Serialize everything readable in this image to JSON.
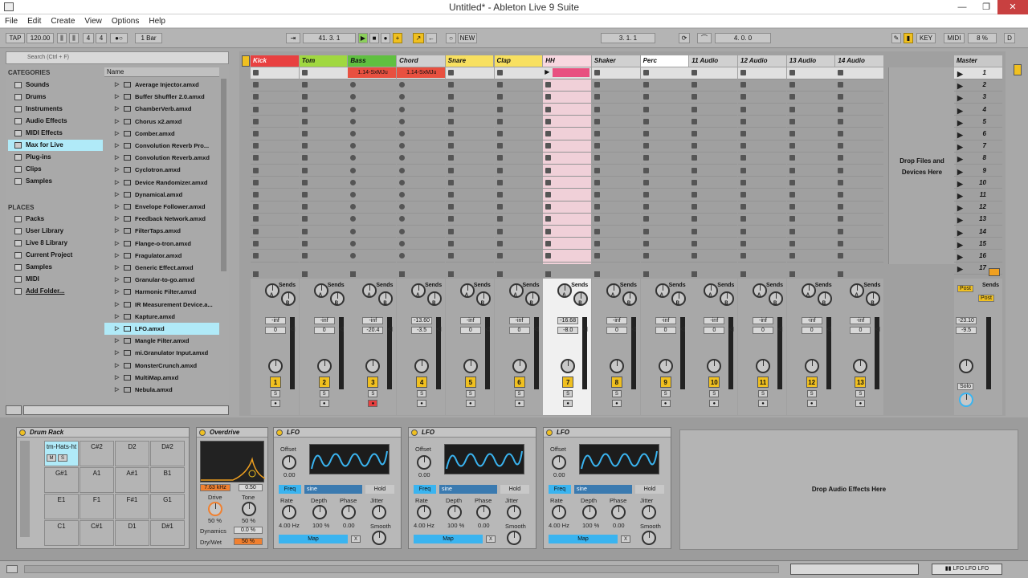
{
  "window": {
    "title": "Untitled* - Ableton Live 9 Suite",
    "minimize": "—",
    "maximize": "❐",
    "close": "✕"
  },
  "menu": [
    "File",
    "Edit",
    "Create",
    "View",
    "Options",
    "Help"
  ],
  "transport": {
    "tap": "TAP",
    "tempo": "120.00",
    "sig_num": "4",
    "sig_den": "4",
    "quant": "1 Bar",
    "position": "41.  3.  1",
    "new": "NEW",
    "loop_start": "3.  1.  1",
    "loop_len": "4.  0.  0",
    "key": "KEY",
    "midi": "MIDI",
    "cpu": "8 %",
    "d": "D"
  },
  "browser": {
    "search_placeholder": "Search (Ctrl + F)",
    "categories_title": "CATEGORIES",
    "categories": [
      "Sounds",
      "Drums",
      "Instruments",
      "Audio Effects",
      "MIDI Effects",
      "Max for Live",
      "Plug-ins",
      "Clips",
      "Samples"
    ],
    "places_title": "PLACES",
    "places": [
      "Packs",
      "User Library",
      "Live 8 Library",
      "Current Project",
      "Samples",
      "MIDI",
      "Add Folder..."
    ],
    "name_col": "Name",
    "files": [
      "Average Injector.amxd",
      "Buffer Shuffler 2.0.amxd",
      "ChamberVerb.amxd",
      "Chorus x2.amxd",
      "Comber.amxd",
      "Convolution Reverb Pro...",
      "Convolution Reverb.amxd",
      "Cyclotron.amxd",
      "Device Randomizer.amxd",
      "Dynamical.amxd",
      "Envelope Follower.amxd",
      "Feedback Network.amxd",
      "FilterTaps.amxd",
      "Flange-o-tron.amxd",
      "Fragulator.amxd",
      "Generic Effect.amxd",
      "Granular-to-go.amxd",
      "Harmonic Filter.amxd",
      "IR Measurement Device.a...",
      "Kapture.amxd",
      "LFO.amxd",
      "Mangle Filter.amxd",
      "mi.Granulator Input.amxd",
      "MonsterCrunch.amxd",
      "MultiMap.amxd",
      "Nebula.amxd"
    ]
  },
  "tracks": [
    {
      "name": "Kick",
      "color": "#e84040",
      "num": "1",
      "vol": "-inf",
      "pan": "0"
    },
    {
      "name": "Tom",
      "color": "#a0d840",
      "num": "2",
      "vol": "-inf",
      "pan": "0"
    },
    {
      "name": "Bass",
      "color": "#60c040",
      "num": "3",
      "vol": "-inf",
      "pan": "-20.4"
    },
    {
      "name": "Chord",
      "color": "#d0d0d0",
      "num": "4",
      "vol": "-13.60",
      "pan": "-3.5"
    },
    {
      "name": "Snare",
      "color": "#f8e060",
      "num": "5",
      "vol": "-inf",
      "pan": "0"
    },
    {
      "name": "Clap",
      "color": "#f8e060",
      "num": "6",
      "vol": "-inf",
      "pan": "0"
    },
    {
      "name": "HH",
      "color": "#f8d8e0",
      "num": "7",
      "vol": "-16.68",
      "pan": "-8.0"
    },
    {
      "name": "Shaker",
      "color": "#d0d0d0",
      "num": "8",
      "vol": "-inf",
      "pan": "0"
    },
    {
      "name": "Perc",
      "color": "#ffffff",
      "num": "9",
      "vol": "-inf",
      "pan": "0"
    },
    {
      "name": "11 Audio",
      "color": "#d0d0d0",
      "num": "10",
      "vol": "-inf",
      "pan": "0"
    },
    {
      "name": "12 Audio",
      "color": "#d0d0d0",
      "num": "11",
      "vol": "-inf",
      "pan": "0"
    },
    {
      "name": "13 Audio",
      "color": "#d0d0d0",
      "num": "12",
      "vol": "-inf",
      "pan": "0"
    },
    {
      "name": "14 Audio",
      "color": "#d0d0d0",
      "num": "13",
      "vol": "-inf",
      "pan": "0"
    }
  ],
  "clips": {
    "bass": "1.14-SxMJu",
    "chord": "1.14-SxMJu"
  },
  "drop_files": "Drop Files and Devices Here",
  "master": {
    "name": "Master",
    "vol": "-23.10",
    "pan": "-9.5",
    "post": "Post",
    "solo": "Solo",
    "scenes": [
      "1",
      "2",
      "3",
      "4",
      "5",
      "6",
      "7",
      "8",
      "9",
      "10",
      "11",
      "12",
      "13",
      "14",
      "15",
      "16",
      "17"
    ]
  },
  "sends_label": "Sends",
  "drum_rack": {
    "title": "Drum Rack",
    "pads": [
      "tm-Hats-ht",
      "C#2",
      "D2",
      "D#2",
      "G#1",
      "A1",
      "A#1",
      "B1",
      "E1",
      "F1",
      "F#1",
      "G1",
      "C1",
      "C#1",
      "D1",
      "D#1"
    ],
    "mute": "M",
    "solo": "S"
  },
  "overdrive": {
    "title": "Overdrive",
    "freq": "7.63 kHz",
    "width": "0.50",
    "drive_label": "Drive",
    "tone_label": "Tone",
    "drive": "50 %",
    "tone": "50 %",
    "dynamics_label": "Dynamics",
    "dynamics": "0.0 %",
    "drywet_label": "Dry/Wet",
    "drywet": "50 %"
  },
  "lfo": {
    "title": "LFO",
    "offset_label": "Offset",
    "offset": "0.00",
    "freq": "Freq",
    "wave": "sine",
    "hold": "Hold",
    "rate_label": "Rate",
    "depth_label": "Depth",
    "phase_label": "Phase",
    "jitter_label": "Jitter",
    "rate": "4.00 Hz",
    "depth": "100 %",
    "phase": "0.00",
    "smooth_label": "Smooth",
    "map": "Map",
    "x": "X"
  },
  "drop_effects": "Drop Audio Effects Here"
}
